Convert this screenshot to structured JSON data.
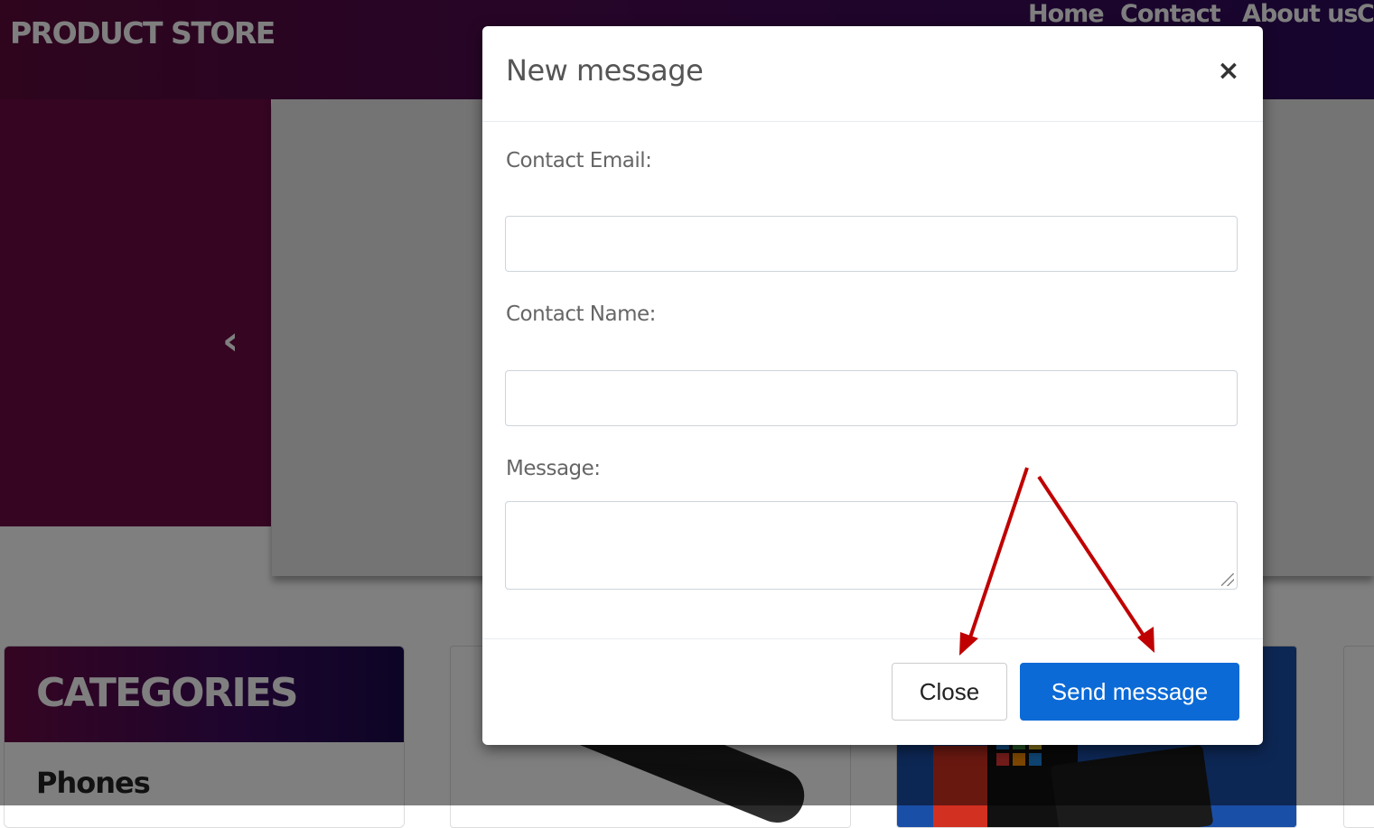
{
  "navbar": {
    "brand": "PRODUCT STORE",
    "links": [
      "Home",
      "Contact",
      "About us",
      "Cart"
    ]
  },
  "hero": {
    "prev_arrow_icon": "chevron-left-icon"
  },
  "sidebar": {
    "categories_title": "CATEGORIES",
    "items": [
      {
        "label": "Phones"
      }
    ]
  },
  "modal": {
    "title": "New message",
    "close_icon": "close-icon",
    "close_glyph": "×",
    "fields": {
      "email_label": "Contact Email:",
      "email_value": "",
      "name_label": "Contact Name:",
      "name_value": "",
      "message_label": "Message:",
      "message_value": ""
    },
    "buttons": {
      "close_label": "Close",
      "send_label": "Send message"
    }
  },
  "colors": {
    "primary_button": "#0b6ad6",
    "annotation_arrow": "#c00000",
    "navbar_start": "#5c0a3a",
    "navbar_end": "#2c0a5c"
  }
}
